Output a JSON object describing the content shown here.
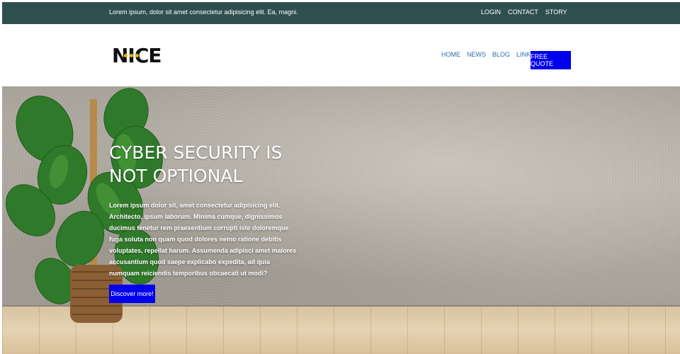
{
  "topbar": {
    "tagline": "Lorem ipsum, dolor sit amet consectetur adipisicing elit. Ea, magni.",
    "links": [
      "LOGIN",
      "CONTACT",
      "STORY"
    ]
  },
  "header": {
    "logo_text": "NICE",
    "nav": [
      "HOME",
      "NEWS",
      "BLOG",
      "LINKS"
    ],
    "quote_label": "FREE QUOTE"
  },
  "hero": {
    "title": "CYBER SECURITY IS NOT OPTIONAL",
    "body": "Lorem ipsum dolor sit, amet consectetur adipisicing elit. Architecto, ipsum laborum. Minima cumque, dignissimos ducimus tenetur rem praesentium corrupti iste doloremque fuga soluta non quam quod dolores nemo ratione debitis voluptates, repellat harum. Assumenda adipisci amet maiores accusantium quod saepe explicabo expedita, ad quia numquam reiciendis temporibus obcaecati ut modi?",
    "cta_label": "Discover more!"
  },
  "colors": {
    "topbar_bg": "#2f4f4f",
    "accent": "#0000ee",
    "nav_link": "#2b6cb0",
    "logo_dot": "#e8b400"
  },
  "icons": [
    "plant-image",
    "logo-mark"
  ]
}
